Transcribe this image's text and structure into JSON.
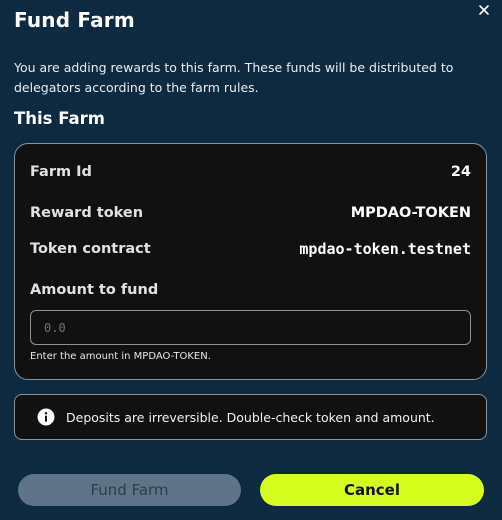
{
  "modal": {
    "title": "Fund Farm",
    "description": "You are adding rewards to this farm. These funds will be distributed to delegators according to the farm rules.",
    "section_title": "This Farm",
    "close_icon": "close-icon"
  },
  "farm": {
    "farm_id_label": "Farm Id",
    "farm_id_value": "24",
    "reward_token_label": "Reward token",
    "reward_token_value": "MPDAO-TOKEN",
    "token_contract_label": "Token contract",
    "token_contract_value": "mpdao-token.testnet"
  },
  "amount": {
    "label": "Amount to fund",
    "placeholder": "0.0",
    "value": "",
    "hint": "Enter the amount in MPDAO-TOKEN."
  },
  "notice": {
    "icon": "info-icon",
    "text": "Deposits are irreversible. Double-check token and amount."
  },
  "actions": {
    "fund_label": "Fund Farm",
    "cancel_label": "Cancel"
  },
  "colors": {
    "background": "#0e2a41",
    "card": "#111111",
    "border": "#8b949c",
    "accent": "#d6ff1f",
    "disabled_button": "#5f7486"
  }
}
